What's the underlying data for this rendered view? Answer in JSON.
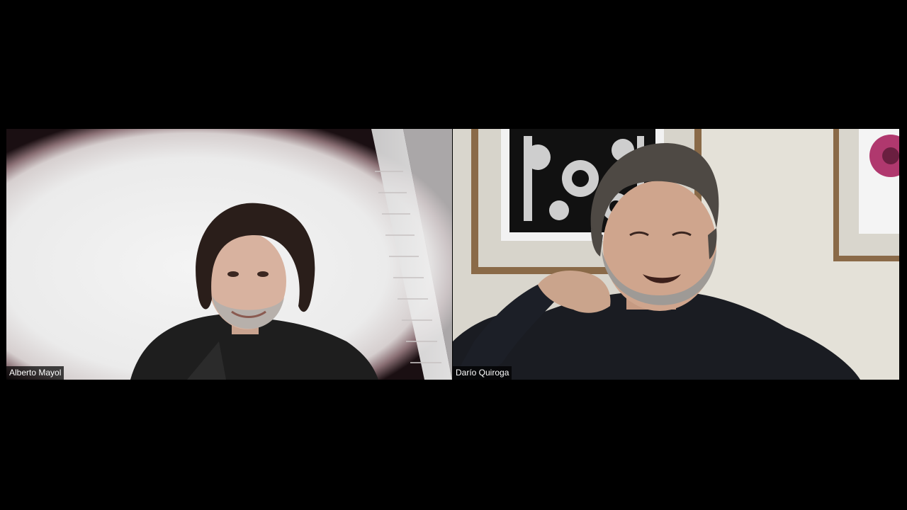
{
  "participants": [
    {
      "name": "Alberto Mayol"
    },
    {
      "name": "Darío Quiroga"
    }
  ],
  "colors": {
    "background": "#000000",
    "name_tag_bg": "#000000",
    "name_tag_text": "#ffffff"
  }
}
